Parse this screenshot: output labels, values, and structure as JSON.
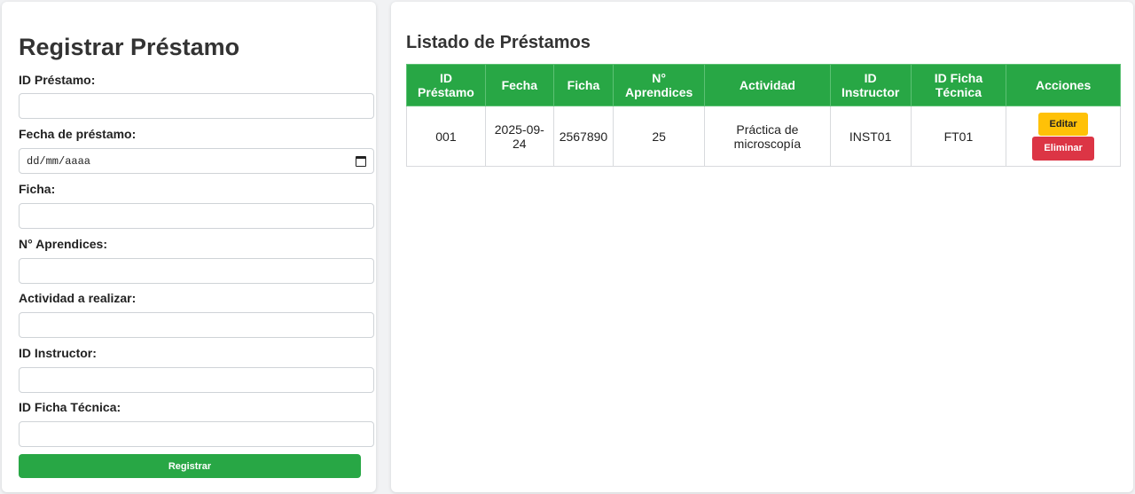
{
  "form": {
    "title": "Registrar Préstamo",
    "fields": [
      {
        "label": "ID Préstamo:",
        "value": ""
      },
      {
        "label": "Fecha de préstamo:",
        "value": "",
        "placeholder": "dd/mm/aaaa"
      },
      {
        "label": "Ficha:",
        "value": ""
      },
      {
        "label": "N° Aprendices:",
        "value": ""
      },
      {
        "label": "Actividad a realizar:",
        "value": ""
      },
      {
        "label": "ID Instructor:",
        "value": ""
      },
      {
        "label": "ID Ficha Técnica:",
        "value": ""
      }
    ],
    "submit_label": "Registrar"
  },
  "list": {
    "title": "Listado de Préstamos",
    "columns": [
      "ID Préstamo",
      "Fecha",
      "Ficha",
      "N° Aprendices",
      "Actividad",
      "ID Instructor",
      "ID Ficha Técnica",
      "Acciones"
    ],
    "rows": [
      {
        "id": "001",
        "fecha": "2025-09-24",
        "ficha": "2567890",
        "aprendices": "25",
        "actividad": "Práctica de microscopía",
        "instructor": "INST01",
        "ficha_tecnica": "FT01",
        "edit_label": "Editar",
        "delete_label": "Eliminar"
      }
    ]
  },
  "colors": {
    "accent_green": "#28a745",
    "edit_yellow": "#ffc107",
    "delete_red": "#dc3545"
  },
  "icons": {
    "date_picker": "calendar-icon"
  }
}
